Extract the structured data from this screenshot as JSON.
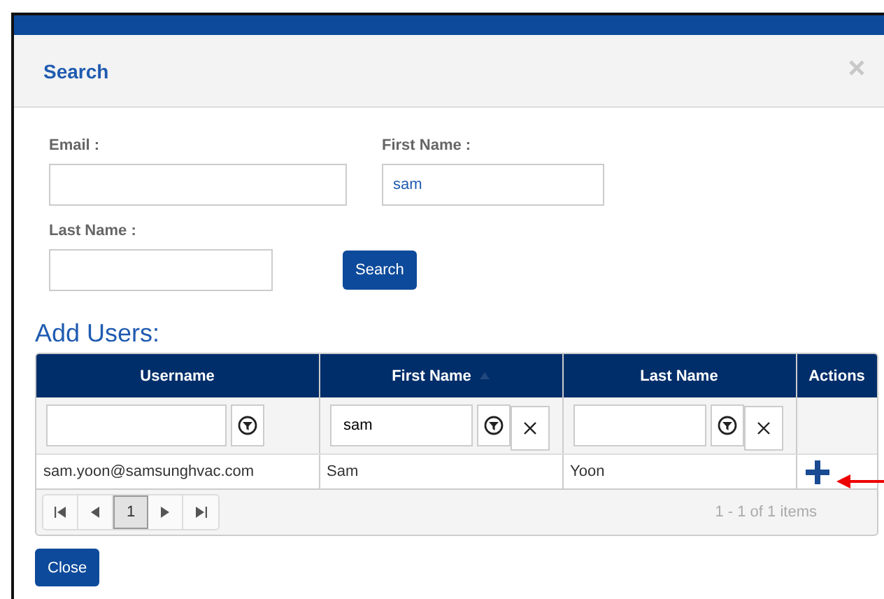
{
  "dialog": {
    "title": "Search"
  },
  "form": {
    "fields": [
      {
        "label": "Email :"
      },
      {
        "label": "First Name :",
        "value": "sam"
      },
      {
        "label": "Last Name :"
      }
    ],
    "search_button": "Search"
  },
  "section_title": "Add Users:",
  "table": {
    "columns": [
      {
        "label": "Username"
      },
      {
        "label": "First Name",
        "sorted": true
      },
      {
        "label": "Last Name"
      },
      {
        "label": "Actions"
      }
    ],
    "filters": [
      {
        "clear_button": false
      },
      {
        "value": "sam",
        "clear_button": true
      },
      {
        "clear_button": true
      }
    ],
    "rows": [
      {
        "cells": [
          "sam.yoon@samsunghvac.com",
          "Sam",
          "Yoon"
        ]
      }
    ],
    "pager": {
      "pages": [
        {
          "label": "1",
          "selected": true
        }
      ],
      "summary": "1 - 1 of 1 items"
    }
  },
  "close_button": "Close"
}
